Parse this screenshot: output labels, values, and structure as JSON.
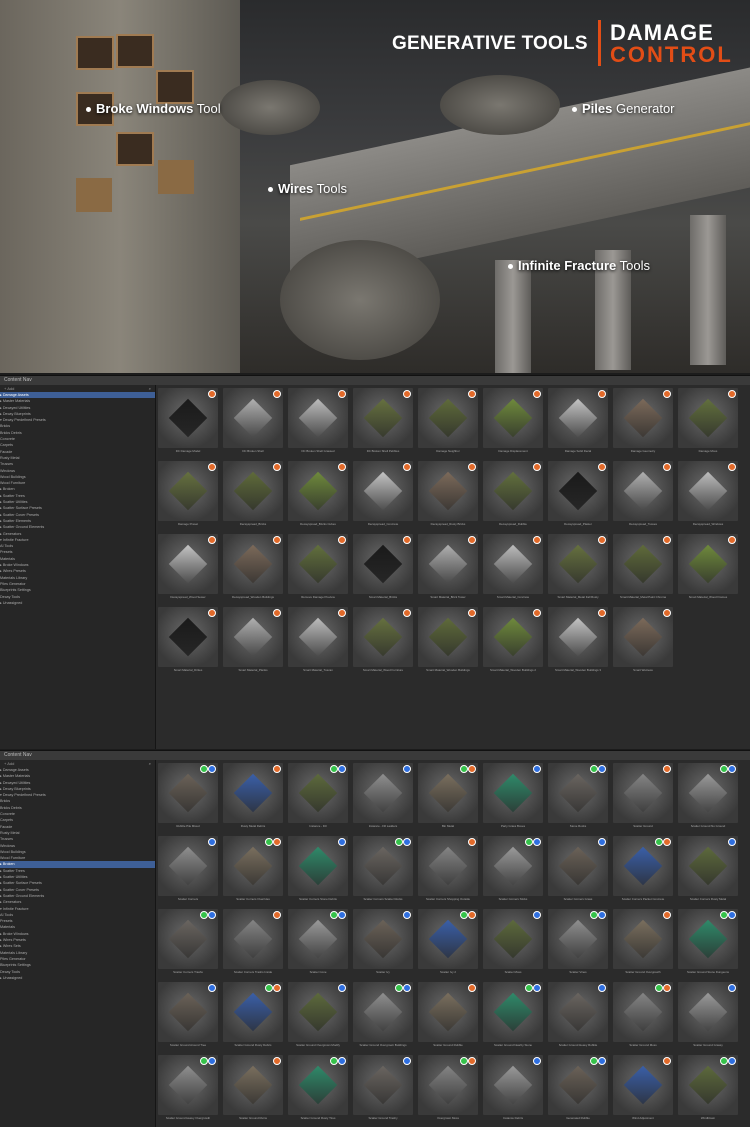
{
  "hero": {
    "heading": "GENERATIVE TOOLS",
    "logo_line1": "DAMAGE",
    "logo_line2": "CONTROL",
    "labels": [
      {
        "bold": "Broke Windows",
        "rest": " Tool"
      },
      {
        "bold": "Wires",
        "rest": " Tools"
      },
      {
        "bold": "Piles",
        "rest": " Generator"
      },
      {
        "bold": "Infinite Fracture",
        "rest": " Tools"
      }
    ],
    "colors": {
      "accent": "#e24d16",
      "text": "#ffffff"
    }
  },
  "panel1": {
    "title": "Content Nav",
    "tree": [
      "▸ Damage Assets",
      "  ▸ Master Materials",
      "  ▸ Decayed Utilities",
      "  ▸ Decay Blueprints",
      "  ▾ Decay Predefined Presets",
      "      Bricks",
      "      Bricks Debris",
      "      Concrete",
      "      Carpets",
      "      Facade",
      "      Rusty Metal",
      "      Trusses",
      "      Windows",
      "      Wood Buildings",
      "      Wood Furniture",
      "  ▸ Broken",
      "    ▸ Scatter Trees",
      "    ▸ Scatter Utilities",
      "    ▸ Scatter Surface Presets",
      "    ▸ Scatter Cover Presets",
      "    ▸ Scatter Elements",
      "    ▸ Scatter Ground Elements",
      "  ▸ Generators",
      "  ▾ Infinite Fracture",
      "      AI Tools",
      "      Presets",
      "      Materials",
      "  ▸ Broke Windows",
      "  ▸ Wires Presets",
      "    Materials Library",
      "    Piles Generator",
      "    Blueprints Settings",
      "    Decay Tools",
      "  ▸ Unassigned"
    ],
    "selected_index": 0,
    "tiles": [
      "DC Damage Model",
      "DC Broken Shell",
      "DC Broken Shell Grassed",
      "DC Broken Shell Pebbles",
      "Damage Neighbor",
      "Damage Displacement",
      "Damage Solid Decal",
      "Damage Geometry",
      "Damage Moss",
      "Damage Preset",
      "Decayspread_Bricks",
      "Decayspread_Bricks Cubes",
      "Decayspread_Concrete",
      "Decayspread_Rusty Bricks",
      "Decayspread_Rubble",
      "Decayspread_Plaster",
      "Decayspread_Tusses",
      "Decayspread_Windows",
      "Decayspread_Wood Sewer",
      "Decayspread_Wooden Buildings",
      "Remove Damage Preview",
      "Smart Material_Bricks",
      "Smart Material_Brick Tower",
      "Smart Material_Concrete",
      "Smart Material_Metal Fall Rusty",
      "Smart Material_Metal Paint Chroma",
      "Smart Material_Wood Frames",
      "Smart Material_Dirties",
      "Smart Material_Planks",
      "Smart Material_Tuscan",
      "Smart Material_Wood Furniture",
      "Smart Material_Wooden Buildings",
      "Smart Material_Wooden Buildings 2",
      "Smart Material_Wooden Buildings 3",
      "Smart Wetness"
    ]
  },
  "panel2": {
    "title": "Content Nav",
    "tree": [
      "▸ Damage Assets",
      "  ▸ Master Materials",
      "  ▸ Decayed Utilities",
      "  ▸ Decay Blueprints",
      "  ▾ Decay Predefined Presets",
      "      Bricks",
      "      Bricks Debris",
      "      Concrete",
      "      Carpets",
      "      Facade",
      "      Rusty Metal",
      "      Trusses",
      "      Windows",
      "      Wood Buildings",
      "      Wood Furniture",
      "  ▸ Broken",
      "    ▸ Scatter Trees",
      "    ▸ Scatter Utilities",
      "    ▸ Scatter Surface Presets",
      "    ▸ Scatter Cover Presets",
      "    ▸ Scatter Ground Elements",
      "  ▸ Generators",
      "  ▾ Infinite Fracture",
      "      AI Tools",
      "      Presets",
      "      Materials",
      "  ▸ Broke Windows",
      "  ▸ Wires Presets",
      "  ▸ Wires Sets",
      "    Materials Library",
      "    Piles Generator",
      "    Blueprints Settings",
      "    Decay Tools",
      "  ▸ Unassigned"
    ],
    "selected_index": 15,
    "tiles": [
      "Rubble Pile Mixed",
      "Rusty Metal Debris",
      "Instance - Fill",
      "Instance - Fill Ladders",
      "Bin Metal",
      "Party Grass Boxes",
      "Stone Rocks",
      "Scatter Ground",
      "Scatter Ground No Ground",
      "Scatter Corners",
      "Scatter Corners Overrides",
      "Scatter Corners Stone Debris",
      "Scatter Corners Scatter Rocks",
      "Scatter Corners Shopping Outside",
      "Scatter Corners Sticks",
      "Scatter Corners Grass",
      "Scatter Corners Packet Concrete",
      "Scatter Corners Rusty Metal",
      "Scatter Corners Trashs",
      "Scatter Corners Trashs Inside",
      "Scatter Cone",
      "Scatter Ivy",
      "Scatter Ivy 2",
      "Scatter Moss",
      "Scatter Vines",
      "Scatter Ground Overgrowth",
      "Scatter Ground Stone Dungeons",
      "Scatter Ground Around Tree",
      "Scatter Ground Rusty Debris",
      "Scatter Ground Overgrown Modify",
      "Scatter Ground Overgrown Buildings",
      "Scatter Ground Rubble",
      "Scatter Ground Nearby Stone",
      "Scatter Ground Heavy Rubble",
      "Scatter Ground Moss",
      "Scatter Ground Grassy",
      "Scatter Ground Heavy Overgrowth",
      "Scatter Ground Ruins",
      "Scatter Ground Rusty Tires",
      "Scatter Ground Trashy",
      "Overgrown Moss",
      "Instance Debris",
      "Generated Rubble",
      "Wind Adjustment",
      "Windblown"
    ]
  }
}
